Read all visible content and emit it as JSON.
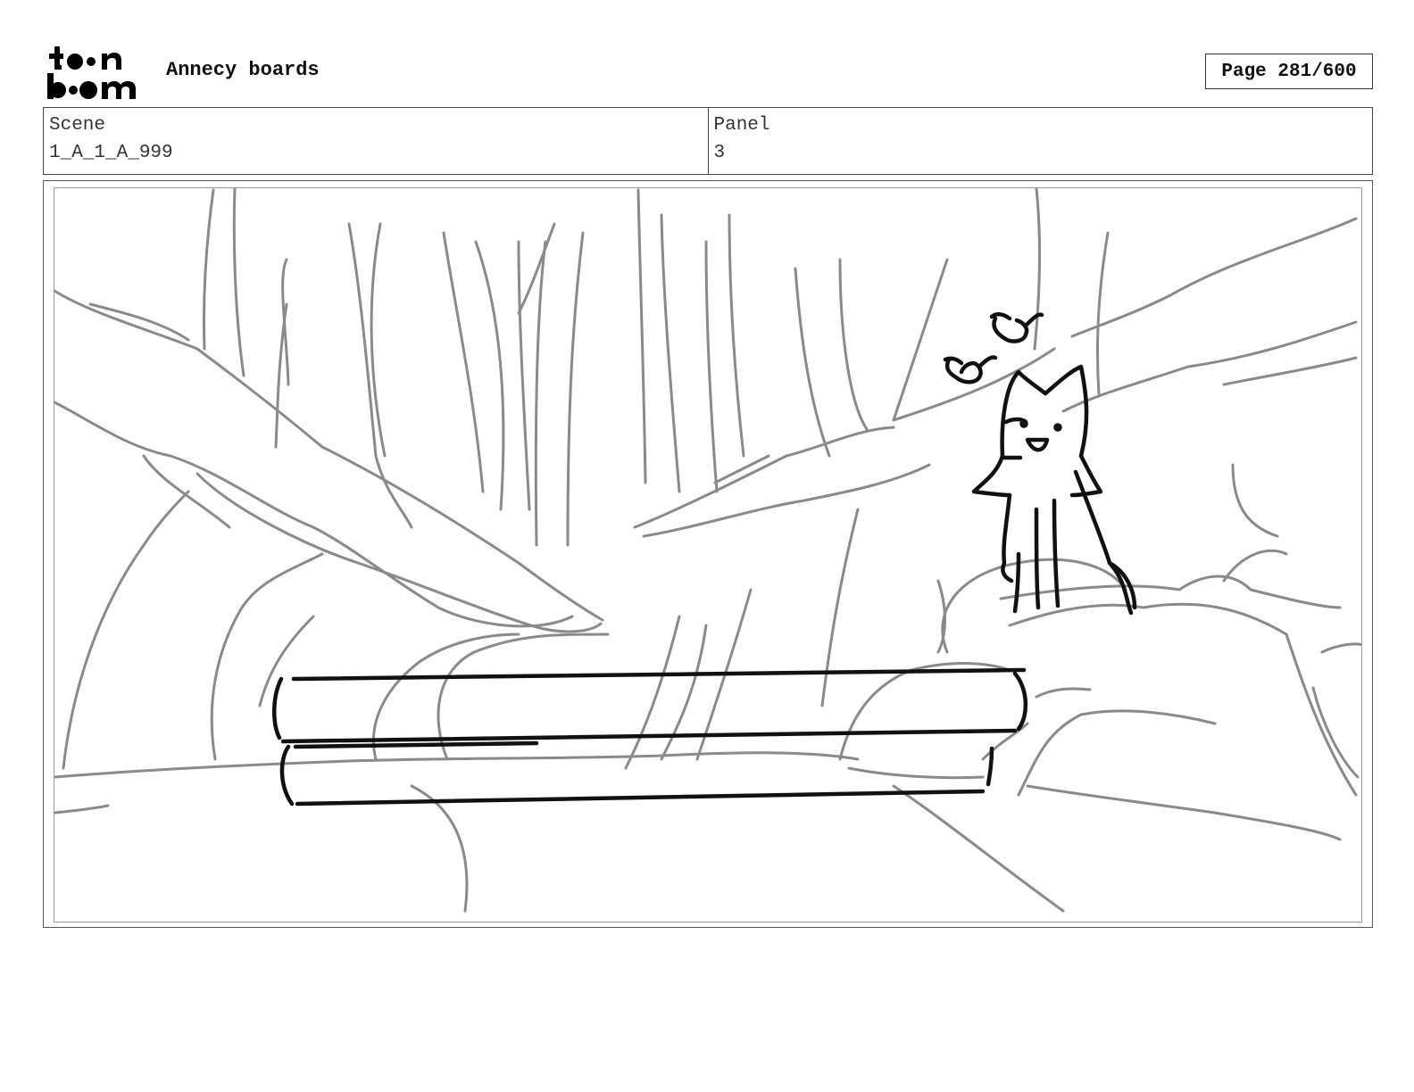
{
  "header": {
    "logo_text": "toon boom",
    "title": "Annecy boards",
    "page_indicator": "Page 281/600"
  },
  "info": {
    "scene_label": "Scene",
    "scene_value": "1_A_1_A_999",
    "panel_label": "Panel",
    "panel_value": "3"
  },
  "panel": {
    "sketch_colors": {
      "background_lines": "#8a8a8a",
      "foreground_lines": "#111111"
    }
  }
}
